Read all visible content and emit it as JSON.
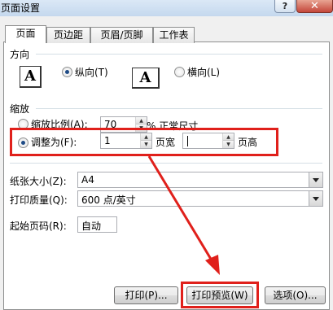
{
  "window": {
    "title": "页面设置",
    "help_label": "?",
    "close_label": "✕"
  },
  "tabs": [
    {
      "label": "页面",
      "active": true
    },
    {
      "label": "页边距",
      "active": false
    },
    {
      "label": "页眉/页脚",
      "active": false
    },
    {
      "label": "工作表",
      "active": false
    }
  ],
  "orientation": {
    "group_label": "方向",
    "portrait_label": "纵向(T)",
    "landscape_label": "横向(L)",
    "selected": "portrait",
    "icon_glyph": "A"
  },
  "scaling": {
    "group_label": "缩放",
    "adjust_label": "缩放比例(A):",
    "adjust_value": "70",
    "adjust_suffix": "% 正常尺寸",
    "fit_label": "调整为(F):",
    "fit_wide_value": "1",
    "fit_wide_suffix": "页宽",
    "fit_tall_value": "",
    "fit_tall_suffix": "页高",
    "selected": "fit"
  },
  "paper_size": {
    "label": "纸张大小(Z):",
    "value": "A4"
  },
  "print_quality": {
    "label": "打印质量(Q):",
    "value": "600 点/英寸"
  },
  "first_page": {
    "label": "起始页码(R):",
    "value": "自动"
  },
  "buttons": {
    "print": "打印(P)...",
    "print_preview": "打印预览(W)",
    "options": "选项(O)..."
  },
  "annotation": {
    "highlight_color": "#e0201b"
  }
}
